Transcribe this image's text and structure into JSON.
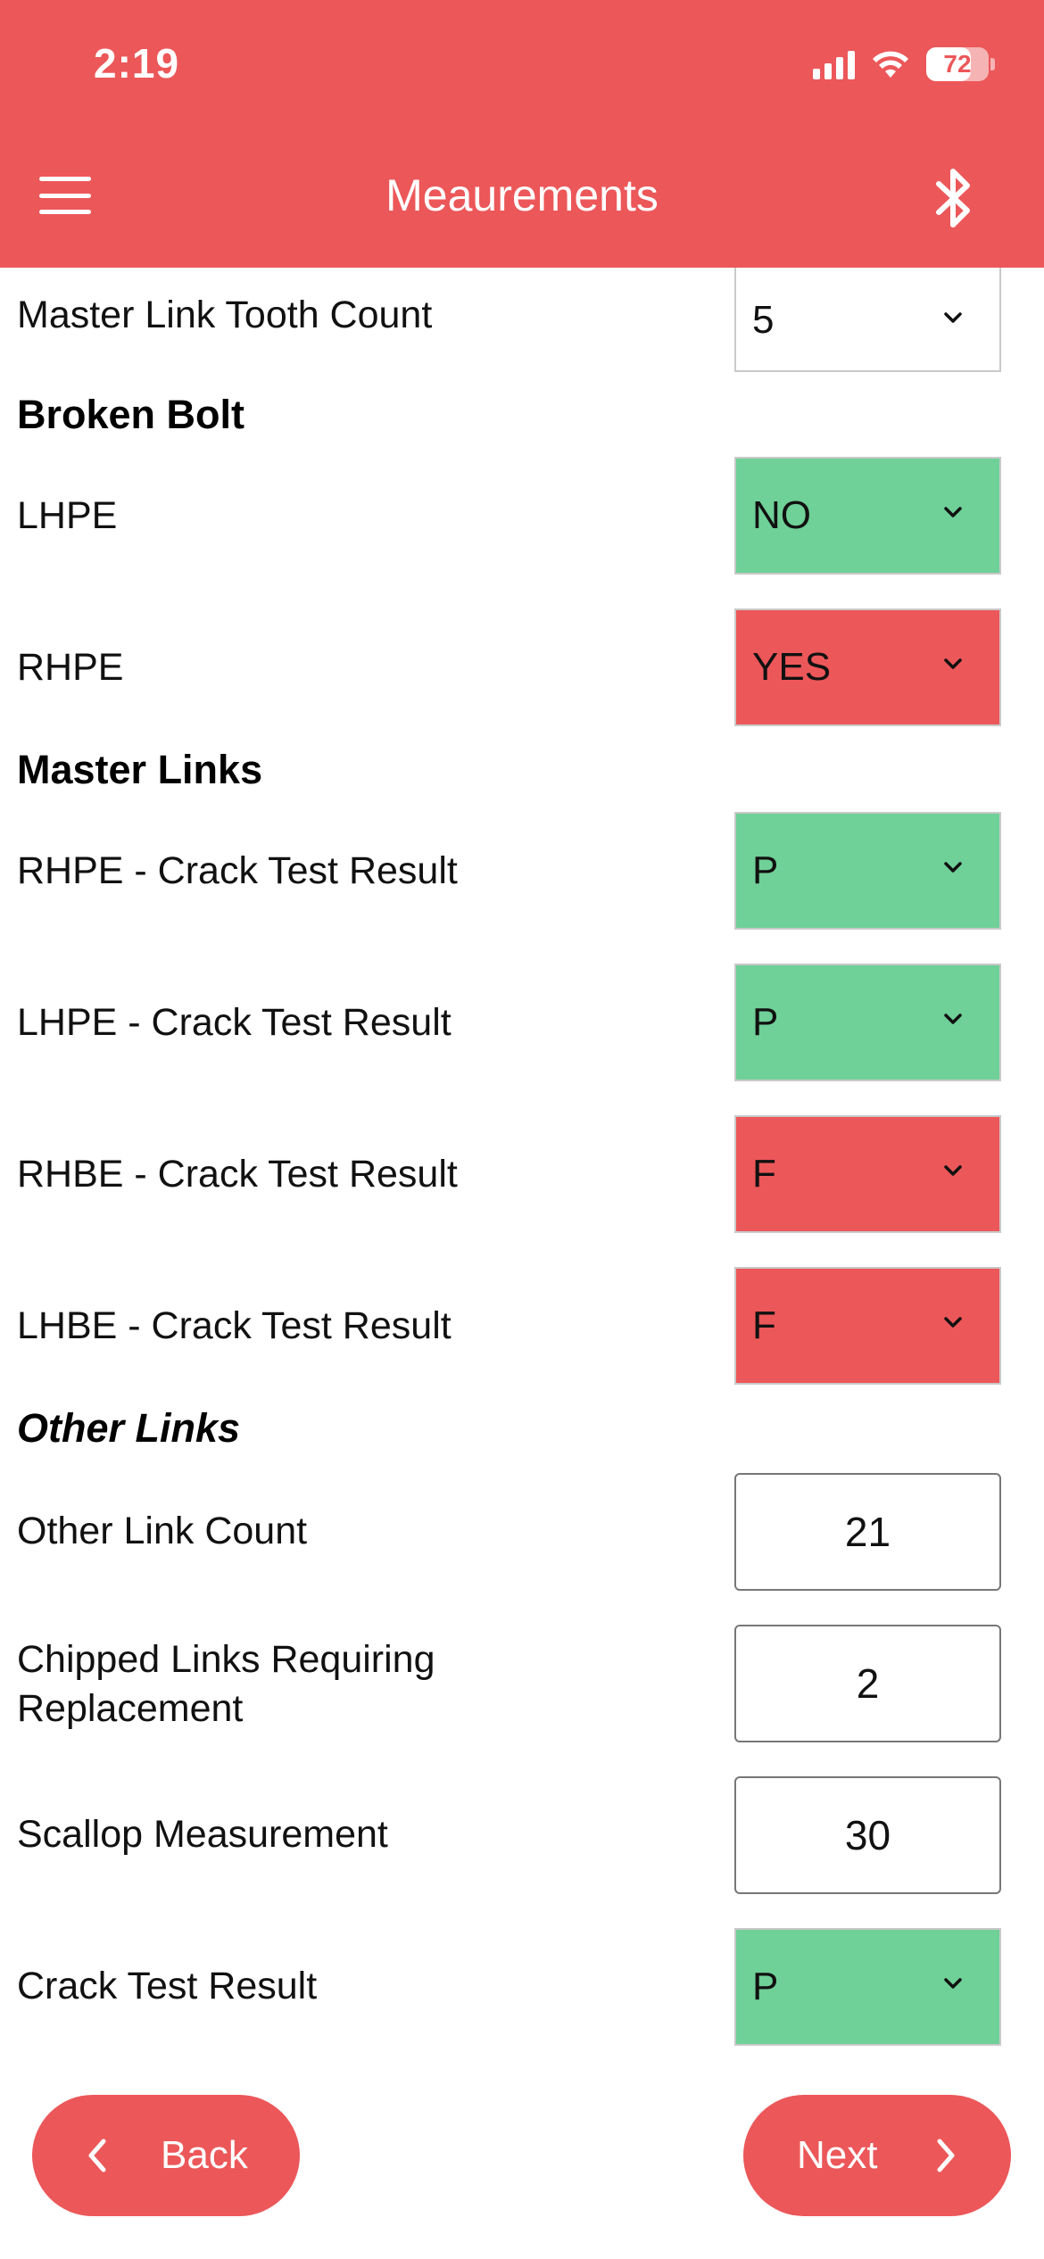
{
  "status_bar": {
    "time": "2:19",
    "battery": "72",
    "battery_level": 0.72
  },
  "header": {
    "title": "Meaurements",
    "menu_icon": "hamburger-menu-icon",
    "bluetooth_icon": "bluetooth-icon"
  },
  "colors": {
    "primary": "#EC5759",
    "pass": "#6FD098",
    "fail": "#EC5759"
  },
  "form": {
    "master_link_tooth_count": {
      "label": "Master Link Tooth Count",
      "value": "5"
    },
    "broken_bolt": {
      "title": "Broken Bolt",
      "lhpe": {
        "label": "LHPE",
        "value": "NO"
      },
      "rhpe": {
        "label": "RHPE",
        "value": "YES"
      }
    },
    "master_links": {
      "title": "Master Links",
      "rhpe_crack": {
        "label": "RHPE - Crack Test Result",
        "value": "P"
      },
      "lhpe_crack": {
        "label": "LHPE - Crack Test Result",
        "value": "P"
      },
      "rhbe_crack": {
        "label": "RHBE - Crack Test Result",
        "value": "F"
      },
      "lhbe_crack": {
        "label": "LHBE - Crack Test Result",
        "value": "F"
      }
    },
    "other_links": {
      "title": "Other Links",
      "other_link_count": {
        "label": "Other Link Count",
        "value": "21"
      },
      "chipped_links": {
        "label_line1": "Chipped Links Requiring",
        "label_line2": "Replacement",
        "value": "2"
      },
      "scallop": {
        "label": "Scallop Measurement",
        "value": "30"
      },
      "crack_test": {
        "label": "Crack Test Result",
        "value": "P"
      }
    }
  },
  "footer": {
    "back_label": "Back",
    "next_label": "Next"
  }
}
